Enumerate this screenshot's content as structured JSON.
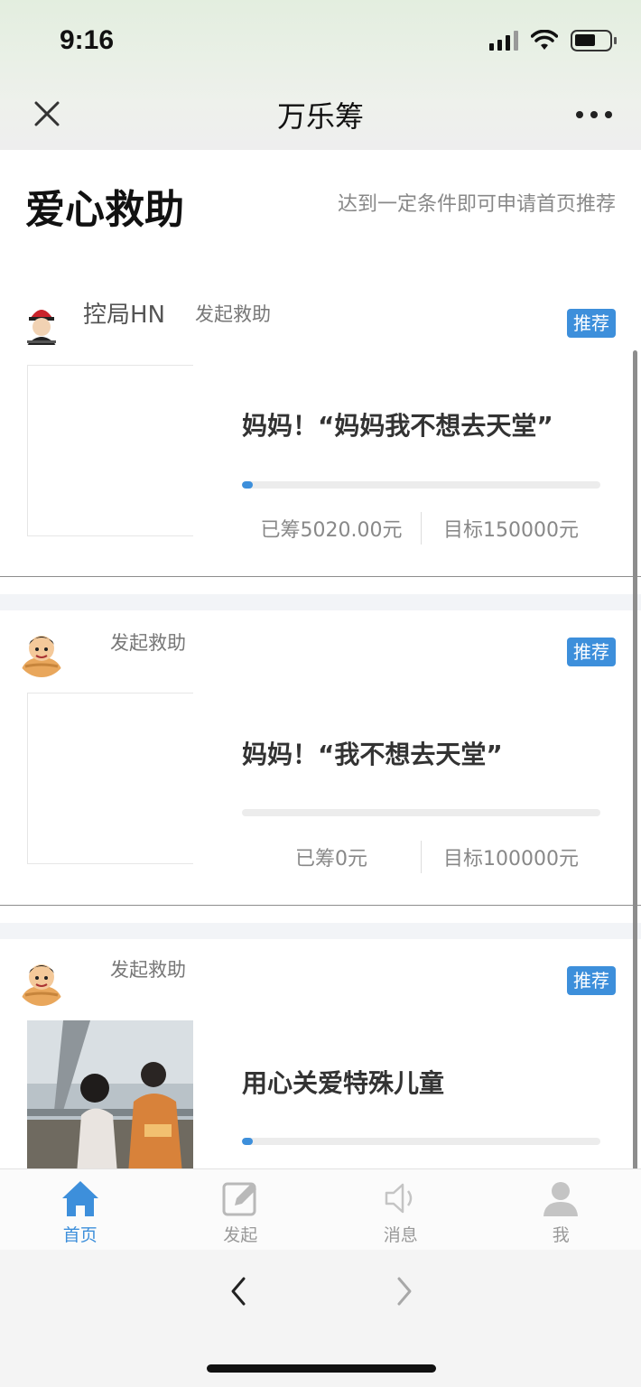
{
  "status": {
    "time": "9:16"
  },
  "nav": {
    "title": "万乐筹"
  },
  "header": {
    "title": "爱心救助",
    "subtitle": "达到一定条件即可申请首页推荐"
  },
  "cards": [
    {
      "author": "控局HN",
      "action": "发起救助",
      "badge": "推荐",
      "title": "妈妈！“妈妈我不想去天堂”",
      "raised": "已筹5020.00元",
      "target": "目标150000元",
      "progress": 0.03
    },
    {
      "author": "",
      "action": "发起救助",
      "badge": "推荐",
      "title": "妈妈！“我不想去天堂”",
      "raised": "已筹0元",
      "target": "目标100000元",
      "progress": 0
    },
    {
      "author": "",
      "action": "发起救助",
      "badge": "推荐",
      "title": "用心关爱特殊儿童",
      "progress": 0.03
    }
  ],
  "tabs": [
    {
      "label": "首页",
      "icon": "home-icon",
      "active": true
    },
    {
      "label": "发起",
      "icon": "edit-icon",
      "active": false
    },
    {
      "label": "消息",
      "icon": "speaker-icon",
      "active": false
    },
    {
      "label": "我",
      "icon": "user-icon",
      "active": false
    }
  ],
  "colors": {
    "accent": "#3d8fdb",
    "muted": "#999999"
  }
}
